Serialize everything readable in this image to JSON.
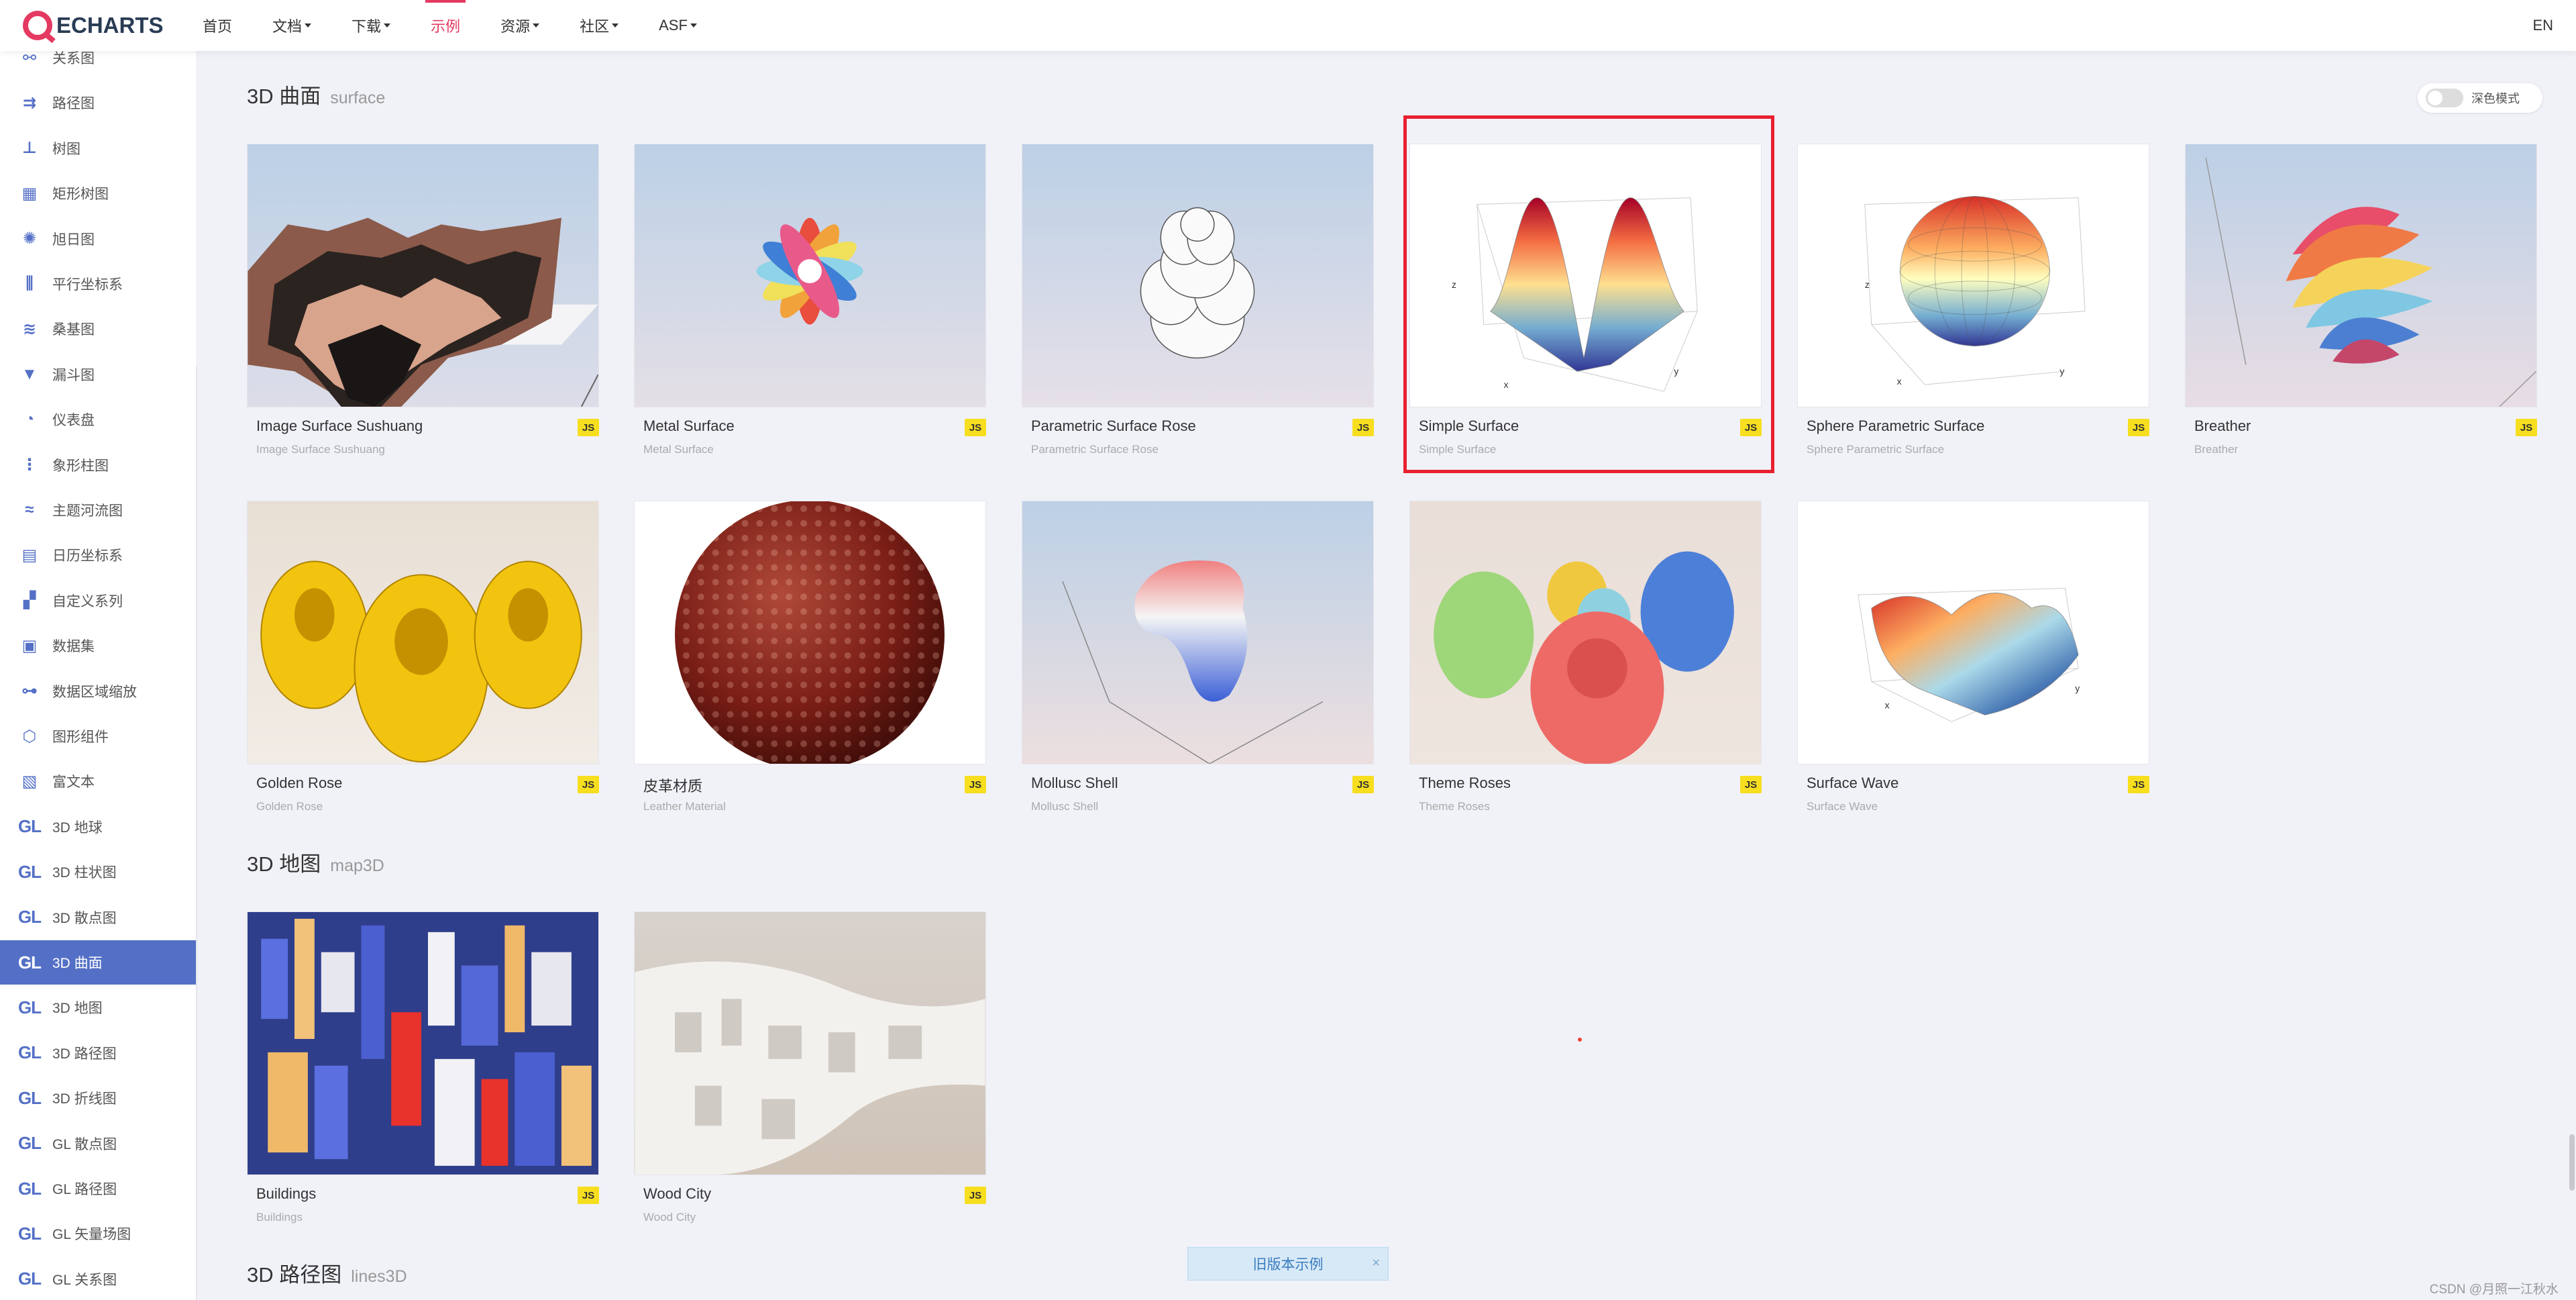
{
  "brand": {
    "logo_text": "ECHARTS"
  },
  "nav": {
    "items": [
      {
        "label": "首页",
        "dropdown": false
      },
      {
        "label": "文档",
        "dropdown": true
      },
      {
        "label": "下载",
        "dropdown": true
      },
      {
        "label": "示例",
        "dropdown": false,
        "active": true
      },
      {
        "label": "资源",
        "dropdown": true
      },
      {
        "label": "社区",
        "dropdown": true
      },
      {
        "label": "ASF",
        "dropdown": true
      }
    ],
    "lang": "EN"
  },
  "sidebar": {
    "items": [
      {
        "label": "关系图",
        "icon": "graph-icon"
      },
      {
        "label": "路径图",
        "icon": "lines-icon"
      },
      {
        "label": "树图",
        "icon": "tree-icon"
      },
      {
        "label": "矩形树图",
        "icon": "treemap-icon"
      },
      {
        "label": "旭日图",
        "icon": "sunburst-icon"
      },
      {
        "label": "平行坐标系",
        "icon": "parallel-icon"
      },
      {
        "label": "桑基图",
        "icon": "sankey-icon"
      },
      {
        "label": "漏斗图",
        "icon": "funnel-icon"
      },
      {
        "label": "仪表盘",
        "icon": "gauge-icon"
      },
      {
        "label": "象形柱图",
        "icon": "pictorial-bar-icon"
      },
      {
        "label": "主题河流图",
        "icon": "theme-river-icon"
      },
      {
        "label": "日历坐标系",
        "icon": "calendar-icon"
      },
      {
        "label": "自定义系列",
        "icon": "custom-icon"
      },
      {
        "label": "数据集",
        "icon": "dataset-icon"
      },
      {
        "label": "数据区域缩放",
        "icon": "datazoom-icon"
      },
      {
        "label": "图形组件",
        "icon": "graphic-icon"
      },
      {
        "label": "富文本",
        "icon": "rich-text-icon"
      },
      {
        "label": "3D 地球",
        "icon": "gl-icon"
      },
      {
        "label": "3D 柱状图",
        "icon": "gl-icon"
      },
      {
        "label": "3D 散点图",
        "icon": "gl-icon"
      },
      {
        "label": "3D 曲面",
        "icon": "gl-icon",
        "active": true
      },
      {
        "label": "3D 地图",
        "icon": "gl-icon"
      },
      {
        "label": "3D 路径图",
        "icon": "gl-icon"
      },
      {
        "label": "3D 折线图",
        "icon": "gl-icon"
      },
      {
        "label": "GL 散点图",
        "icon": "gl-icon"
      },
      {
        "label": "GL 路径图",
        "icon": "gl-icon"
      },
      {
        "label": "GL 矢量场图",
        "icon": "gl-icon"
      },
      {
        "label": "GL 关系图",
        "icon": "gl-icon"
      }
    ],
    "gl_text": "GL"
  },
  "dark_mode": {
    "label": "深色模式"
  },
  "sections": {
    "surface": {
      "title": "3D 曲面",
      "en": "surface",
      "cards": [
        {
          "title": "Image Surface Sushuang",
          "sub": "Image Surface Sushuang",
          "badge": "JS"
        },
        {
          "title": "Metal Surface",
          "sub": "Metal Surface",
          "badge": "JS"
        },
        {
          "title": "Parametric Surface Rose",
          "sub": "Parametric Surface Rose",
          "badge": "JS"
        },
        {
          "title": "Simple Surface",
          "sub": "Simple Surface",
          "badge": "JS"
        },
        {
          "title": "Sphere Parametric Surface",
          "sub": "Sphere Parametric Surface",
          "badge": "JS"
        },
        {
          "title": "Breather",
          "sub": "Breather",
          "badge": "JS"
        },
        {
          "title": "Golden Rose",
          "sub": "Golden Rose",
          "badge": "JS"
        },
        {
          "title": "皮革材质",
          "sub": "Leather Material",
          "badge": "JS"
        },
        {
          "title": "Mollusc Shell",
          "sub": "Mollusc Shell",
          "badge": "JS"
        },
        {
          "title": "Theme Roses",
          "sub": "Theme Roses",
          "badge": "JS"
        },
        {
          "title": "Surface Wave",
          "sub": "Surface Wave",
          "badge": "JS"
        }
      ]
    },
    "map3d": {
      "title": "3D 地图",
      "en": "map3D",
      "cards": [
        {
          "title": "Buildings",
          "sub": "Buildings",
          "badge": "JS"
        },
        {
          "title": "Wood City",
          "sub": "Wood City",
          "badge": "JS"
        }
      ]
    },
    "lines3d": {
      "title": "3D 路径图",
      "en": "lines3D"
    }
  },
  "footer": {
    "old_version": "旧版本示例",
    "close": "×",
    "watermark": "CSDN @月照一江秋水"
  },
  "thumb_axis_labels": {
    "z": "z",
    "x": "x",
    "y": "y"
  }
}
